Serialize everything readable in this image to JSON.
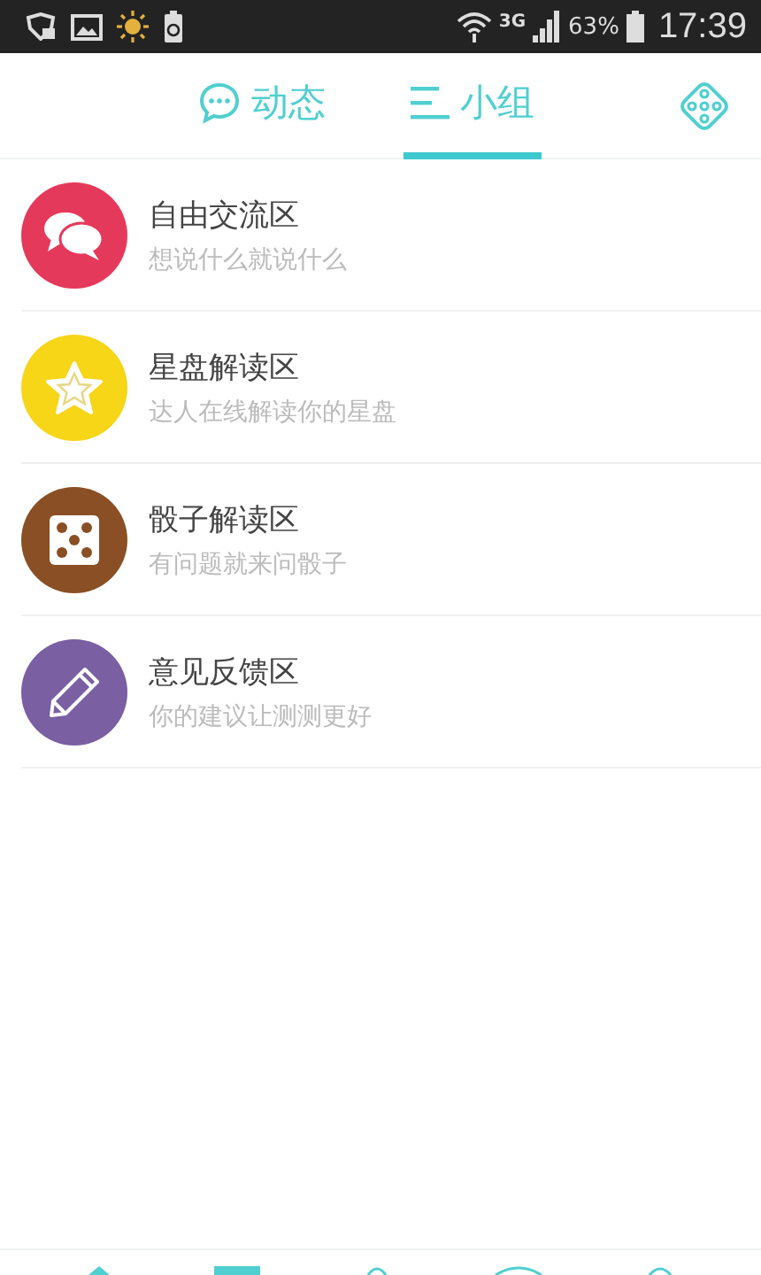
{
  "status_bar": {
    "network": "3G",
    "battery": "63%",
    "time": "17:39"
  },
  "tabs": [
    {
      "label": "动态",
      "kind": "chat",
      "selected": false
    },
    {
      "label": "小组",
      "kind": "list",
      "selected": true
    }
  ],
  "groups": [
    {
      "title": "自由交流区",
      "subtitle": "想说什么就说什么",
      "kind": "chat",
      "color": "#e5395b"
    },
    {
      "title": "星盘解读区",
      "subtitle": "达人在线解读你的星盘",
      "kind": "star",
      "color": "#f7d517"
    },
    {
      "title": "骰子解读区",
      "subtitle": "有问题就来问骰子",
      "kind": "dice",
      "color": "#8a4f24"
    },
    {
      "title": "意见反馈区",
      "subtitle": "你的建议让测测更好",
      "kind": "pencil",
      "color": "#7a5fa3"
    }
  ]
}
